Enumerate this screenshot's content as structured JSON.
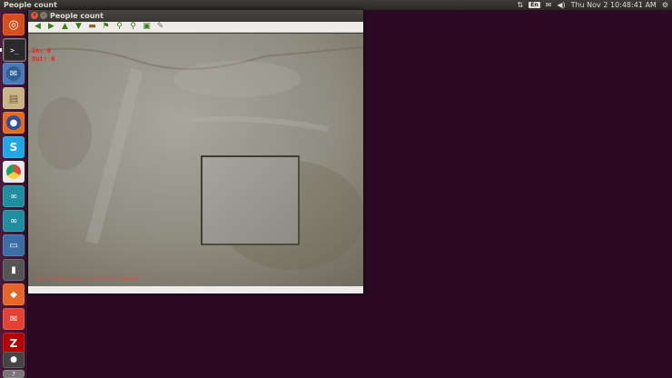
{
  "top_panel": {
    "app_name": "People count",
    "tray": {
      "network_icon": "network-updown-icon",
      "keyboard_label": "En",
      "mail_icon": "mail-icon",
      "volume_icon": "speaker-icon",
      "datetime": "Thu Nov  2 10:48:41 AM",
      "power_icon": "gear-icon"
    }
  },
  "launcher": {
    "items": [
      {
        "name": "ubuntu-dash",
        "icon": "ubuntu-logo-icon",
        "color": "#d74d1b"
      },
      {
        "name": "terminal",
        "icon": "terminal-icon",
        "color": "#2a2a2a"
      },
      {
        "name": "thunderbird",
        "icon": "thunderbird-icon",
        "color": "#4a7cb8"
      },
      {
        "name": "files",
        "icon": "archive-icon",
        "color": "#c9b58a"
      },
      {
        "name": "firefox",
        "icon": "firefox-icon",
        "color": "#e66b1c"
      },
      {
        "name": "skype",
        "icon": "skype-icon",
        "color": "#1fa7e6"
      },
      {
        "name": "chrome",
        "icon": "chrome-icon",
        "color": "#dd4b39"
      },
      {
        "name": "arduino-1",
        "icon": "arduino-icon",
        "color": "#1f8fa0"
      },
      {
        "name": "arduino-2",
        "icon": "arduino-icon",
        "color": "#1f8fa0"
      },
      {
        "name": "remote-desktop",
        "icon": "remote-desktop-icon",
        "color": "#3a6ea5"
      },
      {
        "name": "sd-card",
        "icon": "sd-card-icon",
        "color": "#555555"
      },
      {
        "name": "software-center",
        "icon": "shopping-bag-icon",
        "color": "#e6662a"
      },
      {
        "name": "gmail",
        "icon": "mail-envelope-icon",
        "color": "#e34133"
      },
      {
        "name": "filezilla",
        "icon": "filezilla-icon",
        "color": "#b40000"
      },
      {
        "name": "video-camera",
        "icon": "camera-icon",
        "color": "#444444"
      },
      {
        "name": "unknown-app",
        "icon": "question-icon",
        "color": "#777777"
      }
    ]
  },
  "window": {
    "title": "People count",
    "toolbar": [
      {
        "name": "pan-left",
        "icon": "arrow-left-icon"
      },
      {
        "name": "pan-right",
        "icon": "arrow-right-icon"
      },
      {
        "name": "pan-up",
        "icon": "arrow-up-icon"
      },
      {
        "name": "pan-down",
        "icon": "arrow-down-icon"
      },
      {
        "name": "image-properties",
        "icon": "image-icon"
      },
      {
        "name": "zoom-fit",
        "icon": "flag-icon"
      },
      {
        "name": "zoom-in",
        "icon": "zoom-in-icon"
      },
      {
        "name": "zoom-out",
        "icon": "zoom-out-icon"
      },
      {
        "name": "save",
        "icon": "save-icon"
      },
      {
        "name": "properties",
        "icon": "brush-icon"
      }
    ],
    "overlay": {
      "in_label": "In: 0",
      "out_label": "Out: 0",
      "status_text": "Frame: 217/60 Hz  Sensor: 1 Resolution: (640x480)"
    }
  },
  "colors": {
    "desktop_bg": "#2c0a24",
    "overlay_red": "#ff1a1a",
    "toolbar_green": "#3b7d1c"
  }
}
